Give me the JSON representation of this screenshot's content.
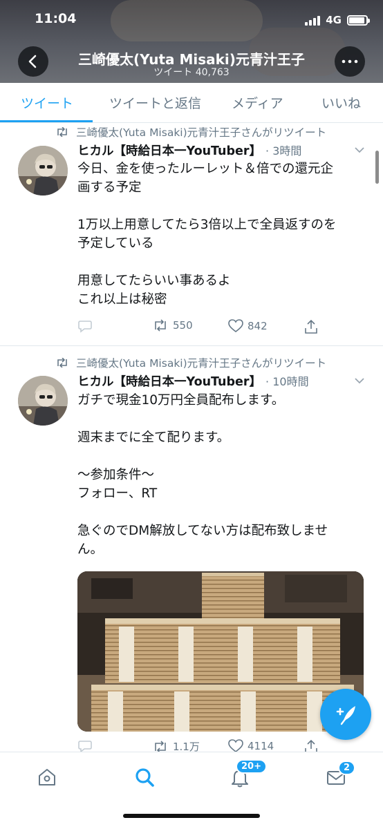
{
  "status_bar": {
    "time": "11:04",
    "network": "4G"
  },
  "header": {
    "title": "三崎優太(Yuta Misaki)元青汁王子",
    "subtitle": "ツイート 40,763",
    "back_icon": "chevron-left-icon",
    "more_icon": "more-dots-icon"
  },
  "tabs": [
    {
      "label": "ツイート",
      "active": true
    },
    {
      "label": "ツイートと返信",
      "active": false
    },
    {
      "label": "メディア",
      "active": false
    },
    {
      "label": "いいね",
      "active": false
    }
  ],
  "tweets": [
    {
      "retweeted_by": "三崎優太(Yuta Misaki)元青汁王子さんがリツイート",
      "author": "ヒカル【時給日本一YouTuber】",
      "time": "· 3時間",
      "lines": [
        "今日、金を使ったルーレット＆倍での還元企",
        "画する予定",
        "",
        "1万以上用意してたら3倍以上で全員返すのを",
        "予定している",
        "",
        "用意してたらいい事あるよ",
        "これ以上は秘密"
      ],
      "retweets": "550",
      "likes": "842"
    },
    {
      "retweeted_by": "三崎優太(Yuta Misaki)元青汁王子さんがリツイート",
      "author": "ヒカル【時給日本一YouTuber】",
      "time": "· 10時間",
      "lines": [
        "ガチで現金10万円全員配布します。",
        "",
        "週末までに全て配ります。",
        "",
        "〜参加条件〜",
        "フォロー、RT",
        "",
        "急ぐのでDM解放してない方は配布致しませ",
        "ん。"
      ],
      "retweets": "1.1万",
      "likes": "4114"
    }
  ],
  "bottom_nav": {
    "notifications_badge": "20+",
    "messages_badge": "2"
  },
  "colors": {
    "accent": "#1da1f2",
    "secondary_text": "#657786",
    "divider": "#e1e8ed"
  }
}
